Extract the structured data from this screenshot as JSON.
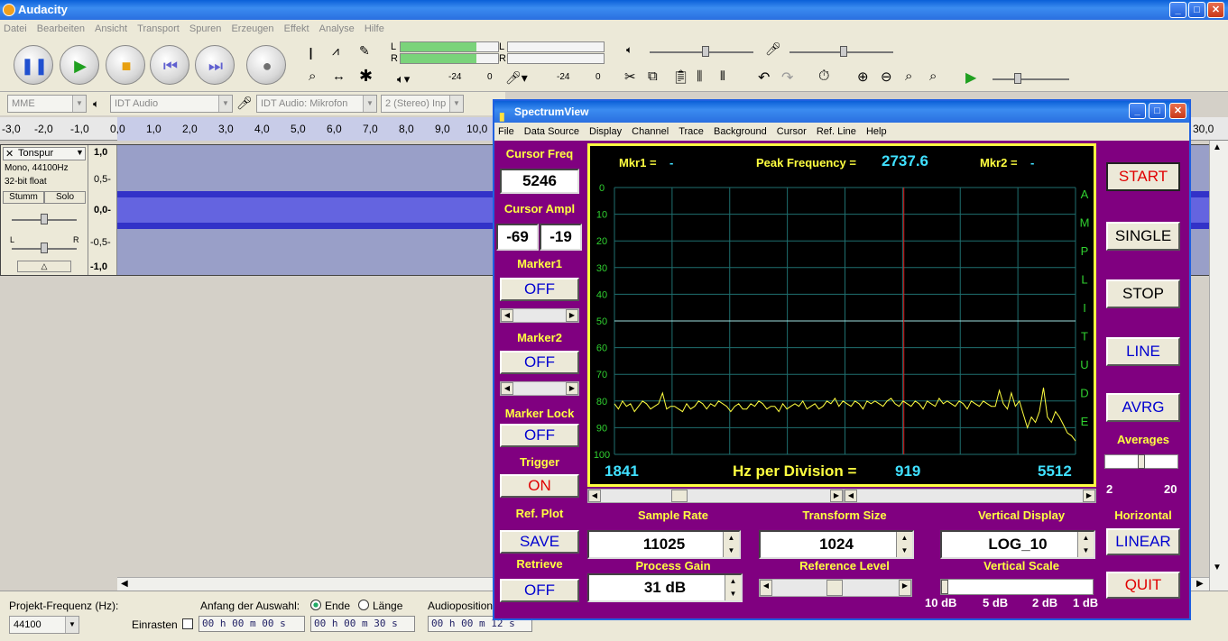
{
  "audacity": {
    "title": "Audacity",
    "menu": [
      "Datei",
      "Bearbeiten",
      "Ansicht",
      "Transport",
      "Spuren",
      "Erzeugen",
      "Effekt",
      "Analyse",
      "Hilfe"
    ],
    "meter_left": "L",
    "meter_right": "R",
    "meter_ticks_a": [
      "-24",
      "0"
    ],
    "meter_ticks_b": [
      "-24",
      "0"
    ],
    "host": "MME",
    "output_device": "IDT Audio",
    "input_device": "IDT Audio: Mikrofon",
    "channels": "2 (Stereo) Inp",
    "ruler_ticks": [
      "-3,0",
      "-2,0",
      "-1,0",
      "0,0",
      "1,0",
      "2,0",
      "3,0",
      "4,0",
      "5,0",
      "6,0",
      "7,0",
      "8,0",
      "9,0",
      "10,0",
      "30,0"
    ],
    "track": {
      "name": "Tonspur",
      "info1": "Mono, 44100Hz",
      "info2": "32-bit float",
      "mute": "Stumm",
      "solo": "Solo",
      "pan_l": "L",
      "pan_r": "R",
      "scale": [
        "1,0",
        "0,5-",
        "0,0-",
        "-0,5-",
        "-1,0"
      ]
    },
    "bottom": {
      "rate_label": "Projekt-Frequenz (Hz):",
      "rate_value": "44100",
      "snap_label": "Einrasten",
      "sel_start_label": "Anfang der Auswahl:",
      "end_label": "Ende",
      "length_label": "Länge",
      "sel_start": "00 h 00 m 00 s",
      "sel_end": "00 h 00 m 30 s",
      "audio_pos_label": "Audioposition:",
      "audio_pos": "00 h 00 m 12 s"
    }
  },
  "spectrum": {
    "title": "SpectrumView",
    "menu": [
      "File",
      "Data Source",
      "Display",
      "Channel",
      "Trace",
      "Background",
      "Cursor",
      "Ref. Line",
      "Help"
    ],
    "cursor_freq_label": "Cursor Freq",
    "cursor_freq": "5246",
    "cursor_ampl_label": "Cursor Ampl",
    "cursor_ampl_a": "-69",
    "cursor_ampl_b": "-19",
    "marker1_label": "Marker1",
    "marker1": "OFF",
    "marker2_label": "Marker2",
    "marker2": "OFF",
    "marker_lock_label": "Marker Lock",
    "marker_lock": "OFF",
    "trigger_label": "Trigger",
    "trigger": "ON",
    "ref_plot_label": "Ref. Plot",
    "save": "SAVE",
    "retrieve_label": "Retrieve",
    "retrieve": "OFF",
    "mkr1_label": "Mkr1 =",
    "mkr1": "-",
    "peak_label": "Peak Frequency =",
    "peak_value": "2737.6",
    "mkr2_label": "Mkr2 =",
    "mkr2": "-",
    "freq_start": "1841",
    "hz_div_label": "Hz per Division =",
    "hz_div": "919",
    "freq_end": "5512",
    "amplitude_letters": [
      "A",
      "M",
      "P",
      "L",
      "I",
      "T",
      "U",
      "D",
      "E"
    ],
    "y_ticks": [
      "0",
      "10",
      "20",
      "30",
      "40",
      "50",
      "60",
      "70",
      "80",
      "90",
      "100"
    ],
    "sample_rate_label": "Sample Rate",
    "sample_rate": "11025",
    "transform_size_label": "Transform Size",
    "transform_size": "1024",
    "vertical_display_label": "Vertical Display",
    "vertical_display": "LOG_10",
    "process_gain_label": "Process Gain",
    "process_gain": "31 dB",
    "reference_level_label": "Reference Level",
    "vertical_scale_label": "Vertical Scale",
    "vscale_ticks": [
      "10 dB",
      "5 dB",
      "2 dB",
      "1 dB"
    ],
    "buttons": {
      "start": "START",
      "single": "SINGLE",
      "stop": "STOP",
      "line": "LINE",
      "avrg": "AVRG",
      "linear": "LINEAR",
      "quit": "QUIT"
    },
    "averages_label": "Averages",
    "averages_min": "2",
    "averages_max": "20",
    "horizontal_label": "Horizontal",
    "colors": {
      "bg": "#800080",
      "grid": "#1f6f6f",
      "trace": "#ffff40",
      "cursor": "#e02020",
      "accent": "#40e0ff"
    },
    "chart_data": {
      "type": "line",
      "xlim": [
        1841,
        5512
      ],
      "ylim": [
        0,
        100
      ],
      "cursor_x": 4145,
      "ref_level": 50,
      "y": [
        81,
        83,
        80,
        82,
        81,
        84,
        82,
        80,
        81,
        83,
        82,
        81,
        77,
        83,
        82,
        82,
        83,
        84,
        81,
        83,
        82,
        80,
        81,
        83,
        81,
        82,
        80,
        81,
        82,
        84,
        82,
        81,
        83,
        83,
        81,
        82,
        80,
        81,
        83,
        82,
        82,
        84,
        81,
        83,
        82,
        81,
        82,
        80,
        83,
        82,
        81,
        83,
        82,
        80,
        81,
        79,
        82,
        80,
        81,
        82,
        80,
        81,
        83,
        80,
        81,
        80,
        81,
        82,
        80,
        79,
        81,
        82,
        80,
        81,
        82,
        80,
        81,
        83,
        80,
        81,
        82,
        79,
        81,
        80,
        81,
        82,
        80,
        81,
        83,
        80,
        81,
        82,
        80,
        81,
        82,
        82,
        76,
        81,
        83,
        77,
        82,
        80,
        85,
        90,
        86,
        88,
        84,
        75,
        86,
        88,
        84,
        86,
        89,
        92,
        93,
        95
      ]
    }
  }
}
